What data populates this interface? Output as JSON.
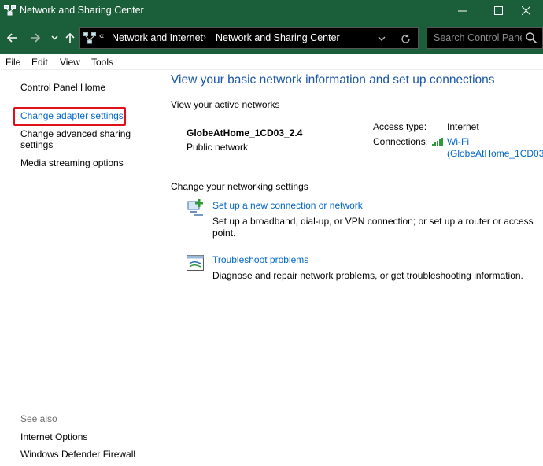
{
  "window": {
    "title": "Network and Sharing Center"
  },
  "address_bar": {
    "overflow": "«",
    "crumbs": [
      "Network and Internet",
      "Network and Sharing Center"
    ],
    "separator": "›"
  },
  "search": {
    "placeholder": "Search Control Panel"
  },
  "menu": [
    "File",
    "Edit",
    "View",
    "Tools"
  ],
  "sidebar": {
    "home": "Control Panel Home",
    "links": [
      "Change adapter settings",
      "Change advanced sharing settings",
      "Media streaming options"
    ],
    "see_also_label": "See also",
    "see_also": [
      "Internet Options",
      "Windows Defender Firewall"
    ]
  },
  "main": {
    "heading": "View your basic network information and set up connections",
    "active_networks_label": "View your active networks",
    "network": {
      "name": "GlobeAtHome_1CD03_2.4",
      "category": "Public network",
      "access_type_label": "Access type:",
      "access_type": "Internet",
      "connections_label": "Connections:",
      "connection_line1": "Wi-Fi",
      "connection_line2": "(GlobeAtHome_1CD03_"
    },
    "change_settings_label": "Change your networking settings",
    "tasks": [
      {
        "icon": "new-connection-icon",
        "link": "Set up a new connection or network",
        "desc": "Set up a broadband, dial-up, or VPN connection; or set up a router or access point."
      },
      {
        "icon": "troubleshoot-icon",
        "link": "Troubleshoot problems",
        "desc": "Diagnose and repair network problems, or get troubleshooting information."
      }
    ]
  },
  "colors": {
    "titlebar": "#1b5e3a",
    "link": "#0066cc",
    "heading": "#1a57a5",
    "highlight": "#e0101a"
  }
}
